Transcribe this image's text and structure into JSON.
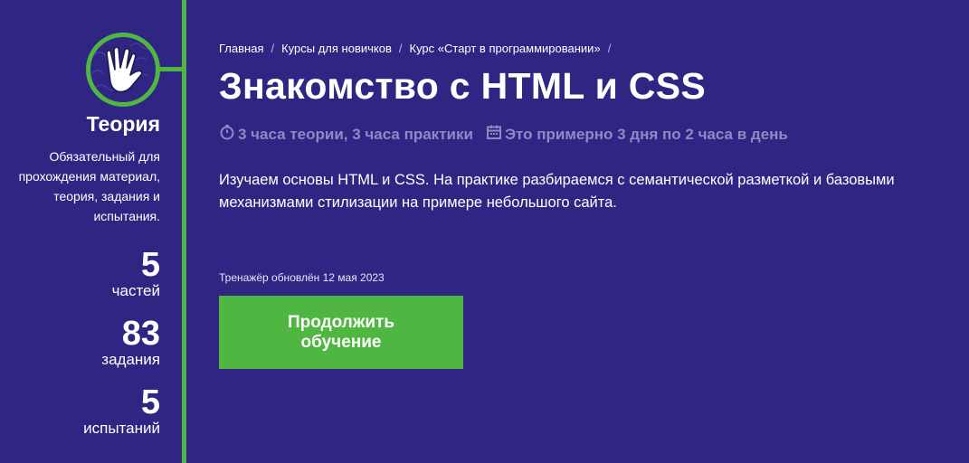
{
  "sidebar": {
    "title": "Теория",
    "description": "Обязательный для прохождения материал, теория, задания и испытания.",
    "stats": [
      {
        "value": "5",
        "label": "частей"
      },
      {
        "value": "83",
        "label": "задания"
      },
      {
        "value": "5",
        "label": "испытаний"
      }
    ],
    "badge_icon": "vulcan-salute-hand-icon"
  },
  "breadcrumb": [
    "Главная",
    "Курсы для новичков",
    "Курс «Старт в программировании»"
  ],
  "breadcrumb_separator": "/",
  "title": "Знакомство с HTML и CSS",
  "meta": {
    "duration": "3 часа теории, 3 часа практики",
    "schedule": "Это примерно 3 дня по 2 часа в день",
    "duration_icon": "stopwatch-icon",
    "schedule_icon": "calendar-icon"
  },
  "description": "Изучаем основы HTML и CSS. На практике разбираемся с семантической разметкой и базовыми механизмами стилизации на примере небольшого сайта.",
  "updated": "Тренажёр обновлён 12 мая 2023",
  "cta_label": "Продолжить обучение",
  "colors": {
    "background": "#2f2684",
    "accent": "#4fb741",
    "muted": "#8f8ac4"
  }
}
